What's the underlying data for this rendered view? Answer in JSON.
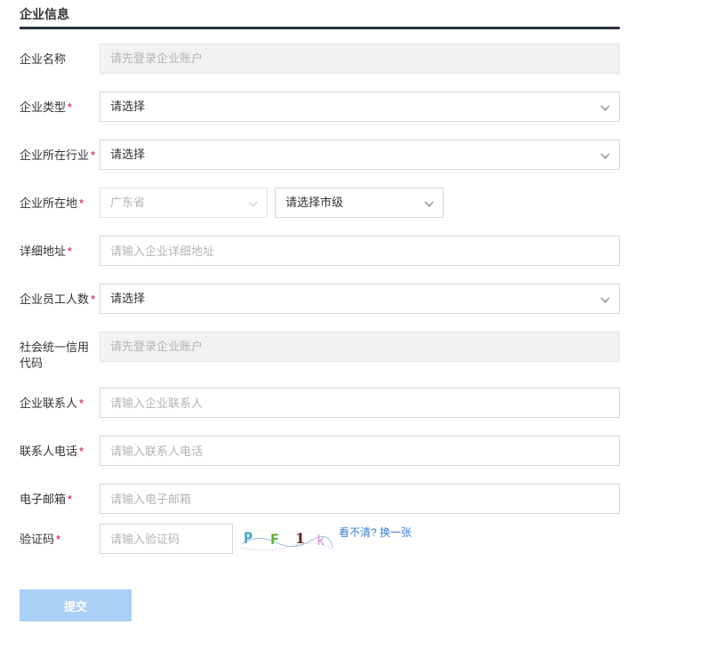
{
  "section_title": "企业信息",
  "required_mark": "*",
  "fields": {
    "company_name": {
      "label": "企业名称",
      "placeholder": "请先登录企业账户"
    },
    "company_type": {
      "label": "企业类型",
      "value": "请选择"
    },
    "company_industry": {
      "label": "企业所在行业",
      "value": "请选择"
    },
    "company_location": {
      "label": "企业所在地",
      "province": "广东省",
      "city": "请选择市级"
    },
    "address": {
      "label": "详细地址",
      "placeholder": "请输入企业详细地址"
    },
    "employee_count": {
      "label": "企业员工人数",
      "value": "请选择"
    },
    "credit_code": {
      "label": "社会统一信用代码",
      "placeholder": "请先登录企业账户"
    },
    "contact_person": {
      "label": "企业联系人",
      "placeholder": "请输入企业联系人"
    },
    "contact_phone": {
      "label": "联系人电话",
      "placeholder": "请输入联系人电话"
    },
    "email": {
      "label": "电子邮箱",
      "placeholder": "请输入电子邮箱"
    },
    "verify_code": {
      "label": "验证码",
      "placeholder": "请输入验证码"
    }
  },
  "captcha": {
    "chars": [
      "P",
      "F",
      "1",
      "k"
    ],
    "colors": [
      "#3aa0c8",
      "#5aa832",
      "#5a2a1a",
      "#d08ad8"
    ],
    "refresh_label": "看不清? 换一张"
  },
  "submit_label": "提交",
  "colors": {
    "accent": "#3a7fd1",
    "required": "#d9001b",
    "submit_bg": "#a9d0f5",
    "title_rule": "#2b3440"
  }
}
